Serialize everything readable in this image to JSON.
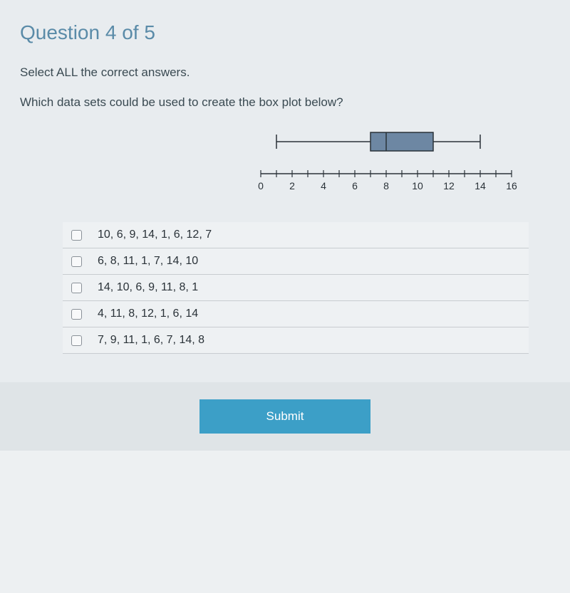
{
  "title": "Question 4 of 5",
  "instruction": "Select ALL the correct answers.",
  "prompt": "Which data sets could be used to create the box plot below?",
  "chart_data": {
    "type": "boxplot",
    "min": 1,
    "q1": 7,
    "median": 8,
    "q3": 11,
    "max": 14,
    "axis": {
      "min": 0,
      "max": 16,
      "tick_interval": 1,
      "labels": [
        "0",
        "2",
        "4",
        "6",
        "8",
        "10",
        "12",
        "14",
        "16"
      ]
    }
  },
  "options": [
    {
      "text": "10, 6, 9, 14, 1, 6, 12, 7"
    },
    {
      "text": "6, 8, 11, 1, 7, 14, 10"
    },
    {
      "text": "14, 10, 6, 9, 11, 8, 1"
    },
    {
      "text": "4, 11, 8, 12, 1, 6, 14"
    },
    {
      "text": "7, 9, 11, 1, 6, 7, 14, 8"
    }
  ],
  "submit_label": "Submit"
}
